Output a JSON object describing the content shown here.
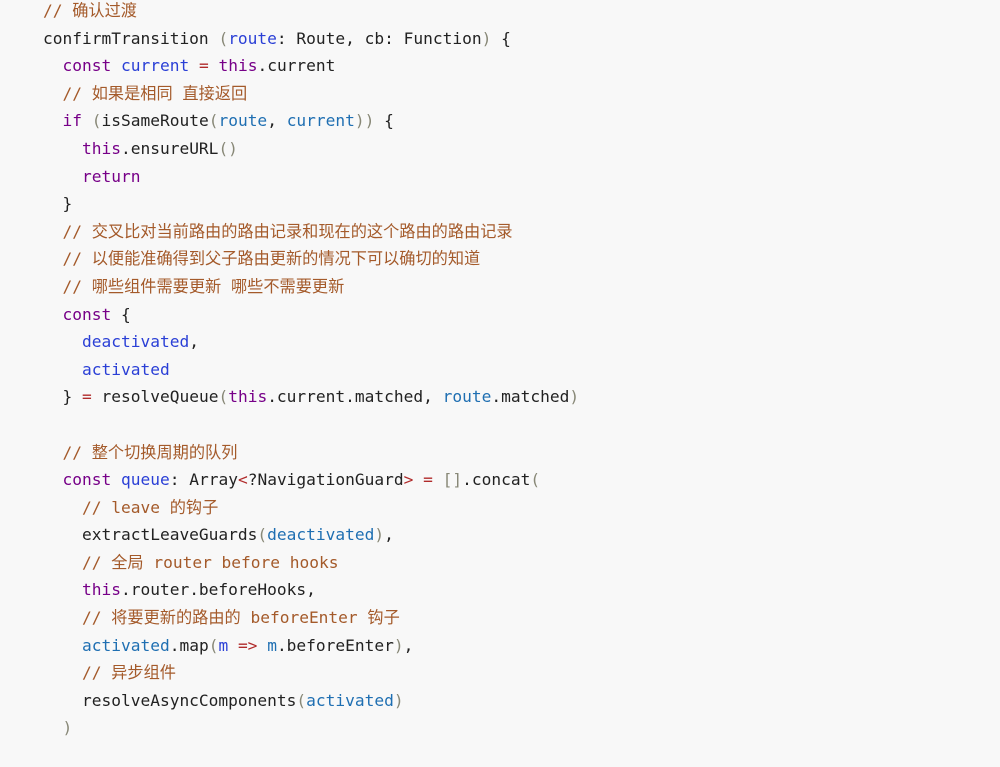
{
  "code": {
    "language": "javascript",
    "lines": [
      {
        "indent": 0,
        "tokens": [
          {
            "t": "// 确认过渡",
            "c": "comment"
          }
        ]
      },
      {
        "indent": 0,
        "tokens": [
          {
            "t": "confirmTransition ",
            "c": "plain"
          },
          {
            "t": "(",
            "c": "bracket"
          },
          {
            "t": "route",
            "c": "def"
          },
          {
            "t": ": Route, cb: Function",
            "c": "plain"
          },
          {
            "t": ")",
            "c": "bracket"
          },
          {
            "t": " {",
            "c": "plain"
          }
        ]
      },
      {
        "indent": 1,
        "tokens": [
          {
            "t": "const",
            "c": "keyword"
          },
          {
            "t": " ",
            "c": "plain"
          },
          {
            "t": "current",
            "c": "def"
          },
          {
            "t": " ",
            "c": "plain"
          },
          {
            "t": "=",
            "c": "operator"
          },
          {
            "t": " ",
            "c": "plain"
          },
          {
            "t": "this",
            "c": "keyword"
          },
          {
            "t": ".current",
            "c": "plain"
          }
        ]
      },
      {
        "indent": 1,
        "tokens": [
          {
            "t": "// 如果是相同 直接返回",
            "c": "comment"
          }
        ]
      },
      {
        "indent": 1,
        "tokens": [
          {
            "t": "if",
            "c": "keyword"
          },
          {
            "t": " ",
            "c": "plain"
          },
          {
            "t": "(",
            "c": "bracket"
          },
          {
            "t": "isSameRoute",
            "c": "plain"
          },
          {
            "t": "(",
            "c": "bracket"
          },
          {
            "t": "route",
            "c": "var2"
          },
          {
            "t": ", ",
            "c": "plain"
          },
          {
            "t": "current",
            "c": "var2"
          },
          {
            "t": "))",
            "c": "bracket"
          },
          {
            "t": " {",
            "c": "plain"
          }
        ]
      },
      {
        "indent": 2,
        "tokens": [
          {
            "t": "this",
            "c": "keyword"
          },
          {
            "t": ".ensureURL",
            "c": "plain"
          },
          {
            "t": "()",
            "c": "bracket"
          }
        ]
      },
      {
        "indent": 2,
        "tokens": [
          {
            "t": "return",
            "c": "keyword"
          }
        ]
      },
      {
        "indent": 1,
        "tokens": [
          {
            "t": "}",
            "c": "plain"
          }
        ]
      },
      {
        "indent": 1,
        "tokens": [
          {
            "t": "// 交叉比对当前路由的路由记录和现在的这个路由的路由记录",
            "c": "comment"
          }
        ]
      },
      {
        "indent": 1,
        "tokens": [
          {
            "t": "// 以便能准确得到父子路由更新的情况下可以确切的知道",
            "c": "comment"
          }
        ]
      },
      {
        "indent": 1,
        "tokens": [
          {
            "t": "// 哪些组件需要更新 哪些不需要更新",
            "c": "comment"
          }
        ]
      },
      {
        "indent": 1,
        "tokens": [
          {
            "t": "const",
            "c": "keyword"
          },
          {
            "t": " {",
            "c": "plain"
          }
        ]
      },
      {
        "indent": 2,
        "tokens": [
          {
            "t": "deactivated",
            "c": "def"
          },
          {
            "t": ",",
            "c": "plain"
          }
        ]
      },
      {
        "indent": 2,
        "tokens": [
          {
            "t": "activated",
            "c": "def"
          }
        ]
      },
      {
        "indent": 1,
        "tokens": [
          {
            "t": "} ",
            "c": "plain"
          },
          {
            "t": "=",
            "c": "operator"
          },
          {
            "t": " resolveQueue",
            "c": "plain"
          },
          {
            "t": "(",
            "c": "bracket"
          },
          {
            "t": "this",
            "c": "keyword"
          },
          {
            "t": ".current.matched, ",
            "c": "plain"
          },
          {
            "t": "route",
            "c": "var2"
          },
          {
            "t": ".matched",
            "c": "plain"
          },
          {
            "t": ")",
            "c": "bracket"
          }
        ]
      },
      {
        "indent": 0,
        "tokens": []
      },
      {
        "indent": 1,
        "tokens": [
          {
            "t": "// 整个切换周期的队列",
            "c": "comment"
          }
        ]
      },
      {
        "indent": 1,
        "tokens": [
          {
            "t": "const",
            "c": "keyword"
          },
          {
            "t": " ",
            "c": "plain"
          },
          {
            "t": "queue",
            "c": "def"
          },
          {
            "t": ": Array",
            "c": "plain"
          },
          {
            "t": "<",
            "c": "operator"
          },
          {
            "t": "?NavigationGuard",
            "c": "plain"
          },
          {
            "t": ">",
            "c": "operator"
          },
          {
            "t": " ",
            "c": "plain"
          },
          {
            "t": "=",
            "c": "operator"
          },
          {
            "t": " ",
            "c": "plain"
          },
          {
            "t": "[]",
            "c": "bracket"
          },
          {
            "t": ".concat",
            "c": "plain"
          },
          {
            "t": "(",
            "c": "bracket"
          }
        ]
      },
      {
        "indent": 2,
        "tokens": [
          {
            "t": "// leave 的钩子",
            "c": "comment"
          }
        ]
      },
      {
        "indent": 2,
        "tokens": [
          {
            "t": "extractLeaveGuards",
            "c": "plain"
          },
          {
            "t": "(",
            "c": "bracket"
          },
          {
            "t": "deactivated",
            "c": "var2"
          },
          {
            "t": ")",
            "c": "bracket"
          },
          {
            "t": ",",
            "c": "plain"
          }
        ]
      },
      {
        "indent": 2,
        "tokens": [
          {
            "t": "// 全局 router before hooks",
            "c": "comment"
          }
        ]
      },
      {
        "indent": 2,
        "tokens": [
          {
            "t": "this",
            "c": "keyword"
          },
          {
            "t": ".router.beforeHooks,",
            "c": "plain"
          }
        ]
      },
      {
        "indent": 2,
        "tokens": [
          {
            "t": "// 将要更新的路由的 beforeEnter 钩子",
            "c": "comment"
          }
        ]
      },
      {
        "indent": 2,
        "tokens": [
          {
            "t": "activated",
            "c": "var2"
          },
          {
            "t": ".map",
            "c": "plain"
          },
          {
            "t": "(",
            "c": "bracket"
          },
          {
            "t": "m",
            "c": "def"
          },
          {
            "t": " ",
            "c": "plain"
          },
          {
            "t": "=>",
            "c": "operator"
          },
          {
            "t": " ",
            "c": "plain"
          },
          {
            "t": "m",
            "c": "var2"
          },
          {
            "t": ".beforeEnter",
            "c": "plain"
          },
          {
            "t": ")",
            "c": "bracket"
          },
          {
            "t": ",",
            "c": "plain"
          }
        ]
      },
      {
        "indent": 2,
        "tokens": [
          {
            "t": "// 异步组件",
            "c": "comment"
          }
        ]
      },
      {
        "indent": 2,
        "tokens": [
          {
            "t": "resolveAsyncComponents",
            "c": "plain"
          },
          {
            "t": "(",
            "c": "bracket"
          },
          {
            "t": "activated",
            "c": "var2"
          },
          {
            "t": ")",
            "c": "bracket"
          }
        ]
      },
      {
        "indent": 1,
        "tokens": [
          {
            "t": ")",
            "c": "bracket"
          }
        ]
      }
    ]
  },
  "colors": {
    "background": "#f8f8f8",
    "comment": "#a45a2a",
    "keyword": "#770088",
    "def": "#2a3fd6",
    "variable": "#1f6fb2",
    "operator": "#b02a2a",
    "bracket": "#888877",
    "text": "#222222"
  }
}
